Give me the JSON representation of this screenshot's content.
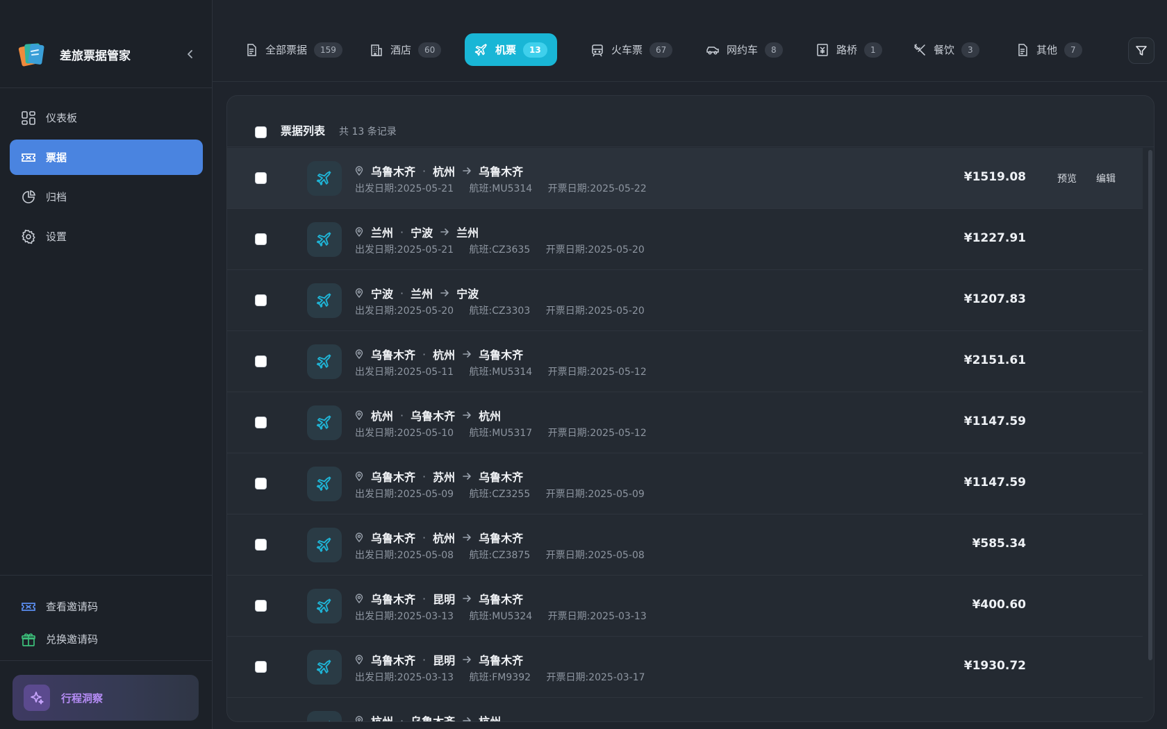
{
  "app": {
    "title": "差旅票据管家"
  },
  "sidebar": {
    "nav": [
      {
        "label": "仪表板",
        "icon": "dashboard-icon"
      },
      {
        "label": "票据",
        "icon": "ticket-icon",
        "active": true
      },
      {
        "label": "归档",
        "icon": "pie-chart-icon"
      },
      {
        "label": "设置",
        "icon": "gear-icon"
      }
    ],
    "bottom": [
      {
        "label": "查看邀请码",
        "icon": "ticket-icon"
      },
      {
        "label": "兑换邀请码",
        "icon": "gift-icon"
      }
    ],
    "insight_label": "行程洞察"
  },
  "tabs": [
    {
      "label": "全部票据",
      "count": "159",
      "icon": "document-icon"
    },
    {
      "label": "酒店",
      "count": "60",
      "icon": "hotel-icon"
    },
    {
      "label": "机票",
      "count": "13",
      "icon": "plane-icon",
      "active": true
    },
    {
      "label": "火车票",
      "count": "67",
      "icon": "train-icon"
    },
    {
      "label": "网约车",
      "count": "8",
      "icon": "car-icon"
    },
    {
      "label": "路桥",
      "count": "1",
      "icon": "toll-icon"
    },
    {
      "label": "餐饮",
      "count": "3",
      "icon": "utensils-icon"
    },
    {
      "label": "其他",
      "count": "7",
      "icon": "document-icon"
    }
  ],
  "list": {
    "title": "票据列表",
    "count_text": "共 13 条记录",
    "actions": {
      "preview": "预览",
      "edit": "编辑"
    },
    "rows": [
      {
        "from": "乌鲁木齐",
        "to": "杭州",
        "back": "乌鲁木齐",
        "depart": "出发日期:2025-05-21",
        "flight": "航班:MU5314",
        "issue": "开票日期:2025-05-22",
        "price": "¥1519.08"
      },
      {
        "from": "兰州",
        "to": "宁波",
        "back": "兰州",
        "depart": "出发日期:2025-05-21",
        "flight": "航班:CZ3635",
        "issue": "开票日期:2025-05-20",
        "price": "¥1227.91"
      },
      {
        "from": "宁波",
        "to": "兰州",
        "back": "宁波",
        "depart": "出发日期:2025-05-20",
        "flight": "航班:CZ3303",
        "issue": "开票日期:2025-05-20",
        "price": "¥1207.83"
      },
      {
        "from": "乌鲁木齐",
        "to": "杭州",
        "back": "乌鲁木齐",
        "depart": "出发日期:2025-05-11",
        "flight": "航班:MU5314",
        "issue": "开票日期:2025-05-12",
        "price": "¥2151.61"
      },
      {
        "from": "杭州",
        "to": "乌鲁木齐",
        "back": "杭州",
        "depart": "出发日期:2025-05-10",
        "flight": "航班:MU5317",
        "issue": "开票日期:2025-05-12",
        "price": "¥1147.59"
      },
      {
        "from": "乌鲁木齐",
        "to": "苏州",
        "back": "乌鲁木齐",
        "depart": "出发日期:2025-05-09",
        "flight": "航班:CZ3255",
        "issue": "开票日期:2025-05-09",
        "price": "¥1147.59"
      },
      {
        "from": "乌鲁木齐",
        "to": "杭州",
        "back": "乌鲁木齐",
        "depart": "出发日期:2025-05-08",
        "flight": "航班:CZ3875",
        "issue": "开票日期:2025-05-08",
        "price": "¥585.34"
      },
      {
        "from": "乌鲁木齐",
        "to": "昆明",
        "back": "乌鲁木齐",
        "depart": "出发日期:2025-03-13",
        "flight": "航班:MU5324",
        "issue": "开票日期:2025-03-13",
        "price": "¥400.60"
      },
      {
        "from": "乌鲁木齐",
        "to": "昆明",
        "back": "乌鲁木齐",
        "depart": "出发日期:2025-03-13",
        "flight": "航班:FM9392",
        "issue": "开票日期:2025-03-17",
        "price": "¥1930.72"
      },
      {
        "from": "杭州",
        "to": "乌鲁木齐",
        "back": "杭州",
        "depart": "",
        "flight": "",
        "issue": "",
        "price": ""
      }
    ]
  },
  "colors": {
    "accent": "#19b6d6",
    "nav_active": "#4a84e0",
    "background": "#1f242c"
  }
}
